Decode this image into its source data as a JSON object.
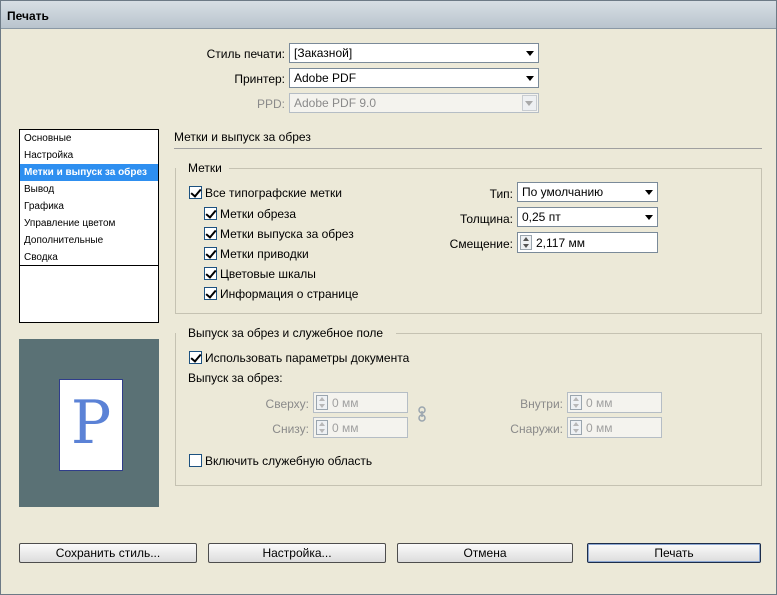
{
  "window": {
    "title": "Печать"
  },
  "top": {
    "style_label": "Стиль печати:",
    "style_value": "[Заказной]",
    "printer_label": "Принтер:",
    "printer_value": "Adobe PDF",
    "ppd_label": "PPD:",
    "ppd_value": "Adobe PDF 9.0"
  },
  "nav": {
    "items": [
      {
        "label": "Основные"
      },
      {
        "label": "Настройка"
      },
      {
        "label": "Метки и выпуск за обрез",
        "active": true
      },
      {
        "label": "Вывод"
      },
      {
        "label": "Графика"
      },
      {
        "label": "Управление цветом"
      },
      {
        "label": "Дополнительные"
      },
      {
        "label": "Сводка"
      }
    ]
  },
  "preview": {
    "letter": "P"
  },
  "main": {
    "section_title": "Метки и выпуск за обрез",
    "marks": {
      "title": "Метки",
      "all_marks": "Все типографские метки",
      "crop_marks": "Метки обреза",
      "bleed_marks": "Метки выпуска за обрез",
      "registration_marks": "Метки приводки",
      "color_bars": "Цветовые шкалы",
      "page_info": "Информация о странице",
      "type_label": "Тип:",
      "type_value": "По умолчанию",
      "weight_label": "Толщина:",
      "weight_value": "0,25 пт",
      "offset_label": "Смещение:",
      "offset_value": "2,117 мм"
    },
    "bleed": {
      "title": "Выпуск за обрез и служебное поле",
      "use_doc": "Использовать параметры документа",
      "bleed_label": "Выпуск за обрез:",
      "top_label": "Сверху:",
      "top_value": "0 мм",
      "bottom_label": "Снизу:",
      "bottom_value": "0 мм",
      "inside_label": "Внутри:",
      "inside_value": "0 мм",
      "outside_label": "Снаружи:",
      "outside_value": "0 мм",
      "slug": "Включить служебную область"
    }
  },
  "buttons": {
    "save_style": "Сохранить стиль...",
    "setup": "Настройка...",
    "cancel": "Отмена",
    "print": "Печать"
  }
}
